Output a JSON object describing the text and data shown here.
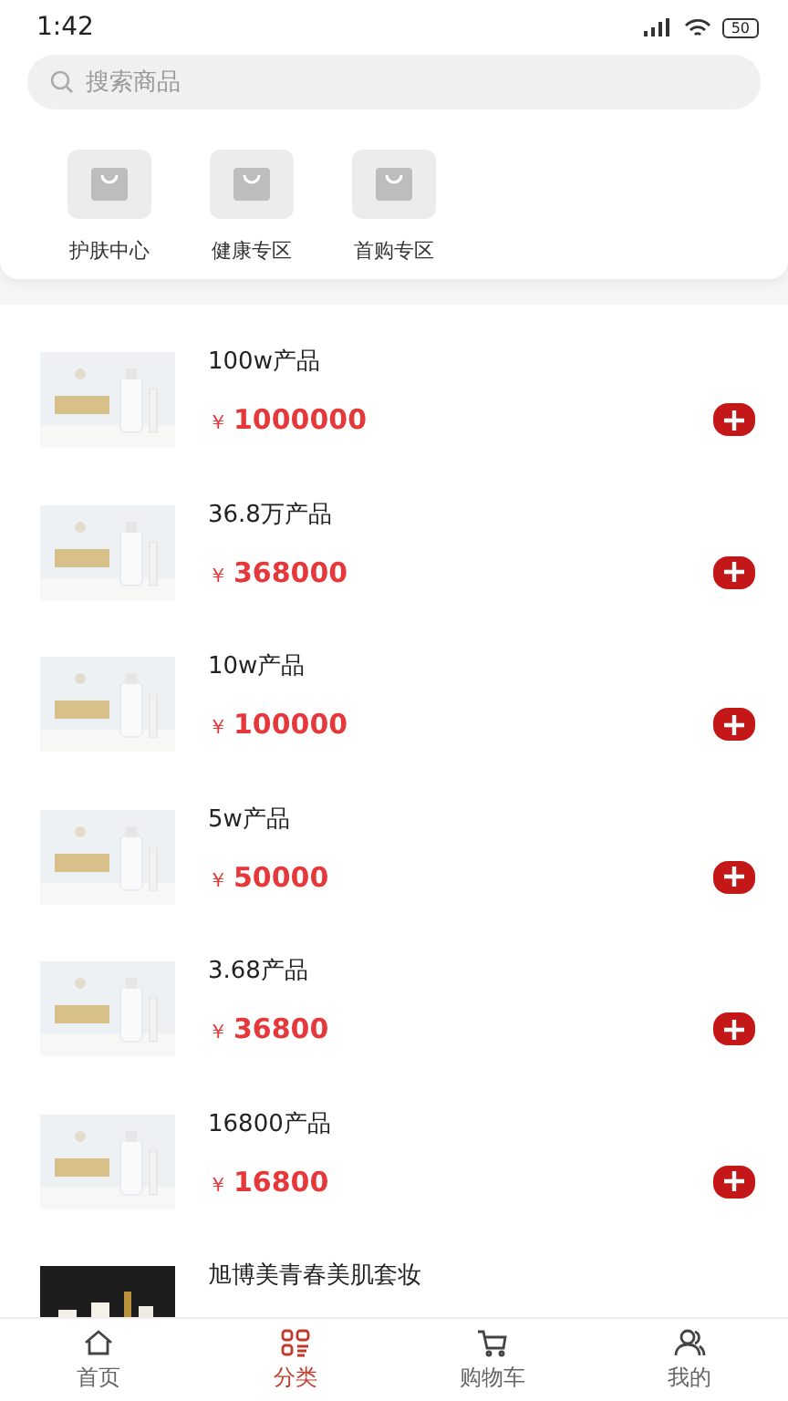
{
  "status_bar": {
    "time": "1:42",
    "battery": "50"
  },
  "search": {
    "placeholder": "搜索商品"
  },
  "categories": [
    {
      "label": "护肤中心"
    },
    {
      "label": "健康专区"
    },
    {
      "label": "首购专区"
    }
  ],
  "products": [
    {
      "name": "100w产品",
      "currency": "￥",
      "price": "1000000"
    },
    {
      "name": "36.8万产品",
      "currency": "￥",
      "price": "368000"
    },
    {
      "name": "10w产品",
      "currency": "￥",
      "price": "100000"
    },
    {
      "name": "5w产品",
      "currency": "￥",
      "price": "50000"
    },
    {
      "name": "3.68产品",
      "currency": "￥",
      "price": "36800"
    },
    {
      "name": "16800产品",
      "currency": "￥",
      "price": "16800"
    },
    {
      "name": "旭博美青春美肌套妆"
    }
  ],
  "tab_bar": [
    {
      "label": "首页",
      "selected": false
    },
    {
      "label": "分类",
      "selected": true
    },
    {
      "label": "购物车",
      "selected": false
    },
    {
      "label": "我的",
      "selected": false
    }
  ]
}
